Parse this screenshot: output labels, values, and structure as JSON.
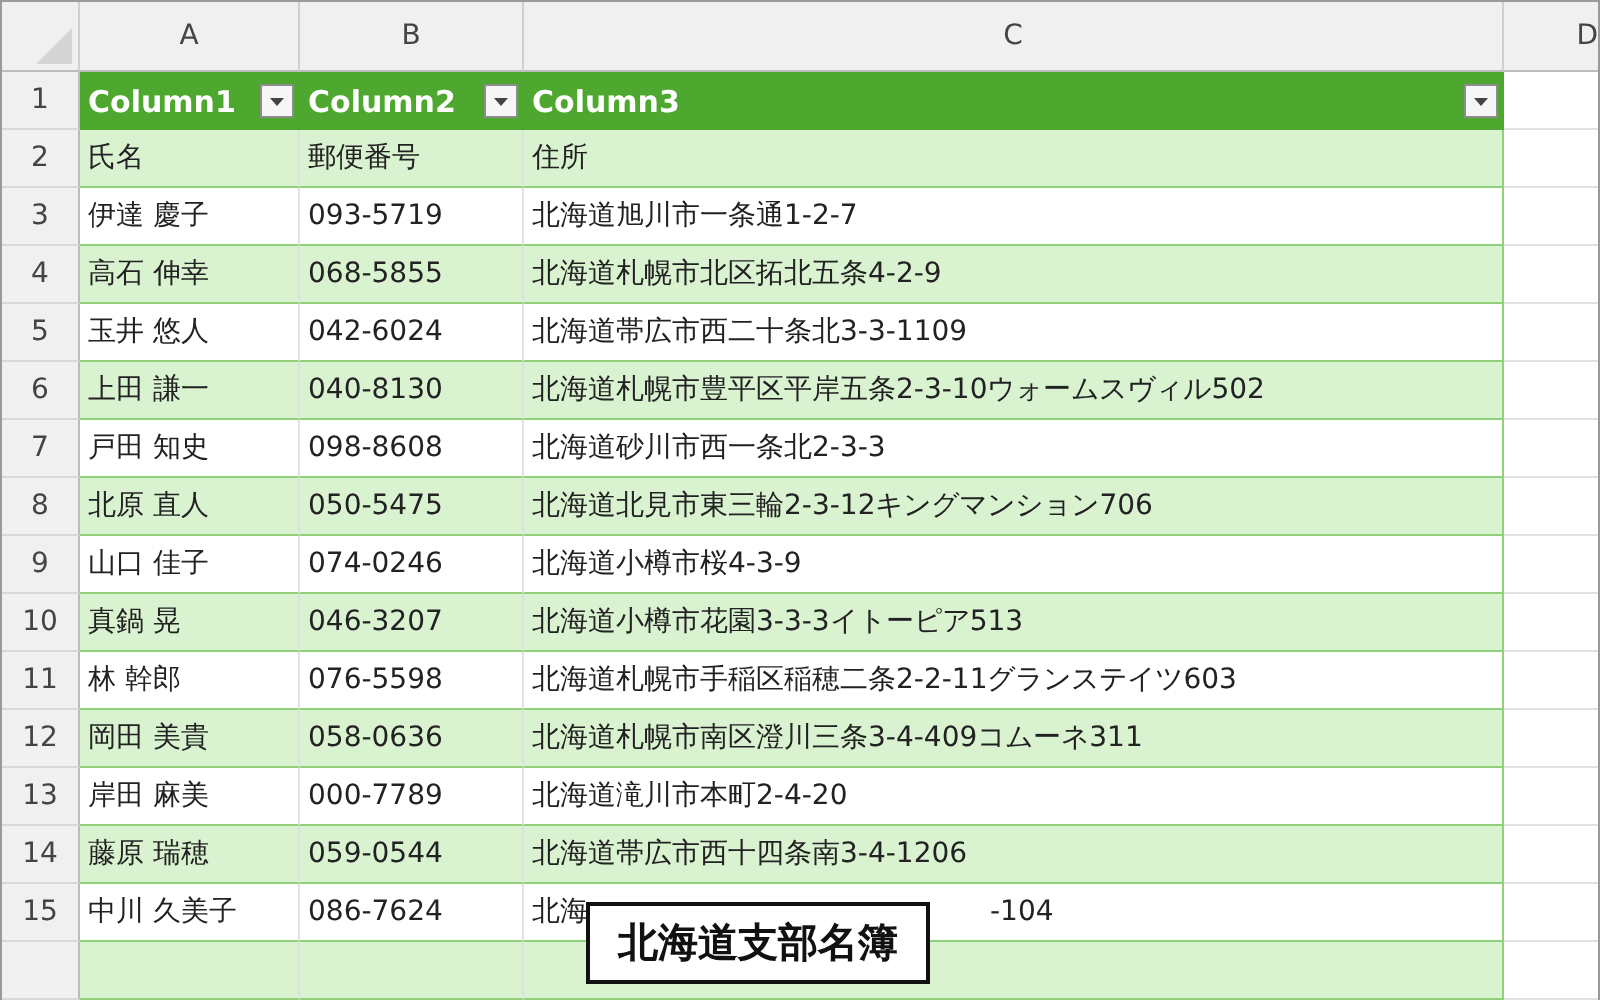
{
  "column_headers": [
    "A",
    "B",
    "C",
    "D"
  ],
  "table_header": {
    "num": "1",
    "cells": [
      {
        "label": "Column1",
        "filter": true
      },
      {
        "label": "Column2",
        "filter": true
      },
      {
        "label": "Column3",
        "filter": true
      }
    ]
  },
  "rows": [
    {
      "num": "2",
      "cells": [
        "氏名",
        "郵便番号",
        "住所"
      ]
    },
    {
      "num": "3",
      "cells": [
        "伊達 慶子",
        "093-5719",
        "北海道旭川市一条通1-2-7"
      ]
    },
    {
      "num": "4",
      "cells": [
        "高石 伸幸",
        "068-5855",
        "北海道札幌市北区拓北五条4-2-9"
      ]
    },
    {
      "num": "5",
      "cells": [
        "玉井 悠人",
        "042-6024",
        "北海道帯広市西二十条北3-3-1109"
      ]
    },
    {
      "num": "6",
      "cells": [
        "上田 謙一",
        "040-8130",
        "北海道札幌市豊平区平岸五条2-3-10ウォームスヴィル502"
      ]
    },
    {
      "num": "7",
      "cells": [
        "戸田 知史",
        "098-8608",
        "北海道砂川市西一条北2-3-3"
      ]
    },
    {
      "num": "8",
      "cells": [
        "北原 直人",
        "050-5475",
        "北海道北見市東三輪2-3-12キングマンション706"
      ]
    },
    {
      "num": "9",
      "cells": [
        "山口 佳子",
        "074-0246",
        "北海道小樽市桜4-3-9"
      ]
    },
    {
      "num": "10",
      "cells": [
        "真鍋 晃",
        "046-3207",
        "北海道小樽市花園3-3-3イトーピア513"
      ]
    },
    {
      "num": "11",
      "cells": [
        "林 幹郎",
        "076-5598",
        "北海道札幌市手稲区稲穂二条2-2-11グランステイツ603"
      ]
    },
    {
      "num": "12",
      "cells": [
        "岡田 美貴",
        "058-0636",
        "北海道札幌市南区澄川三条3-4-409コムーネ311"
      ]
    },
    {
      "num": "13",
      "cells": [
        "岸田 麻美",
        "000-7789",
        "北海道滝川市本町2-4-20"
      ]
    },
    {
      "num": "14",
      "cells": [
        "藤原 瑞穂",
        "059-0544",
        "北海道帯広市西十四条南3-4-1206"
      ]
    },
    {
      "num": "15",
      "cells": [
        "中川 久美子",
        "086-7624",
        "北海"
      ],
      "hidden_tail": "-104"
    }
  ],
  "caption": "北海道支部名簿"
}
